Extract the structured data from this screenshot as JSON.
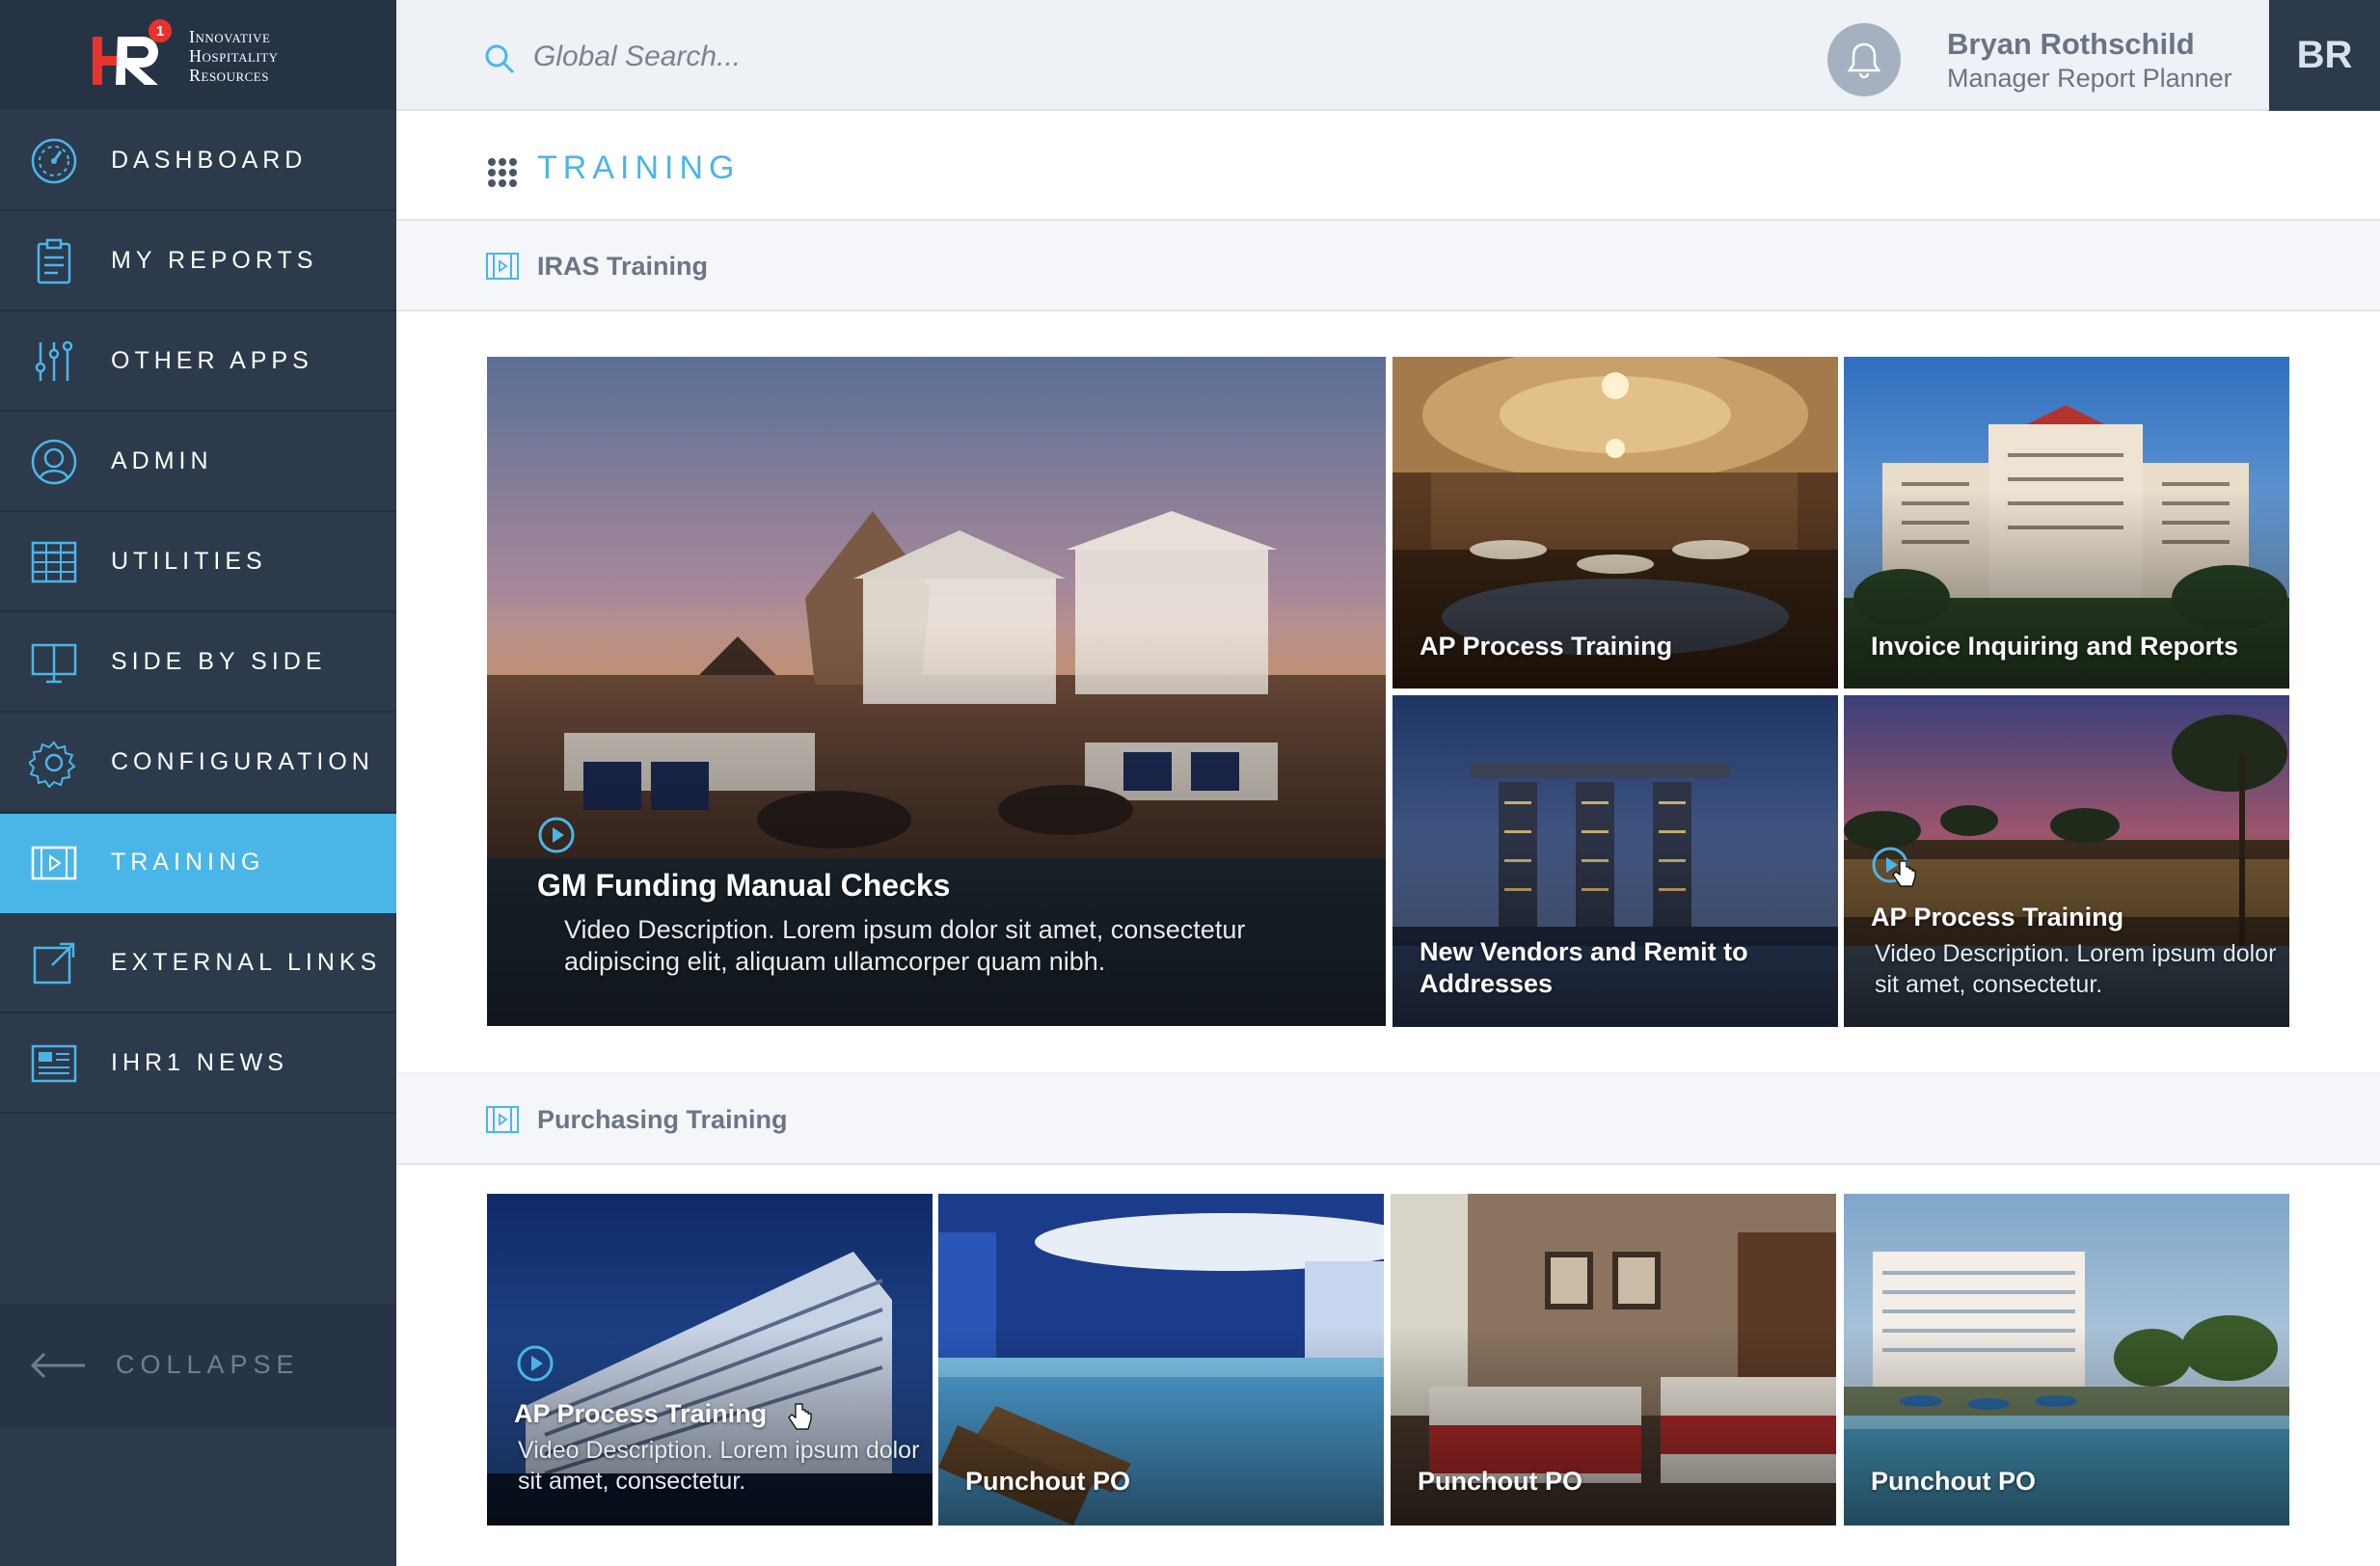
{
  "brand": {
    "logo_mark": "HR",
    "logo_badge": "1",
    "logo_lines": [
      "Innovative",
      "Hospitality",
      "Resources"
    ]
  },
  "sidebar": {
    "items": [
      {
        "label": "DASHBOARD",
        "icon": "dashboard-gauge-icon"
      },
      {
        "label": "MY REPORTS",
        "icon": "clipboard-icon"
      },
      {
        "label": "OTHER APPS",
        "icon": "sliders-icon"
      },
      {
        "label": "ADMIN",
        "icon": "user-circle-icon"
      },
      {
        "label": "UTILITIES",
        "icon": "table-grid-icon"
      },
      {
        "label": "SIDE BY SIDE",
        "icon": "monitor-icon"
      },
      {
        "label": "CONFIGURATION",
        "icon": "gear-icon"
      },
      {
        "label": "TRAINING",
        "icon": "film-icon",
        "active": true
      },
      {
        "label": "EXTERNAL LINKS",
        "icon": "external-link-icon"
      },
      {
        "label": "IHR1 NEWS",
        "icon": "newspaper-icon"
      }
    ],
    "collapse_label": "COLLAPSE"
  },
  "topbar": {
    "search_placeholder": "Global Search...",
    "user_name": "Bryan Rothschild",
    "user_role": "Manager Report Planner",
    "avatar_initials": "BR"
  },
  "page": {
    "title": "TRAINING"
  },
  "sections": [
    {
      "title": "IRAS Training",
      "tiles": [
        {
          "title": "GM Funding Manual Checks",
          "desc": "Video Description. Lorem ipsum dolor sit amet, consectetur adipiscing elit, aliquam ullamcorper quam nibh.",
          "play": true,
          "scene": "rooftop-lounge-sunset"
        },
        {
          "title": "AP Process Training",
          "scene": "ornate-ballroom"
        },
        {
          "title": "Invoice Inquiring and Reports",
          "scene": "resort-hotel-facade"
        },
        {
          "title": "New Vendors and Remit to Addresses",
          "scene": "city-skyline-dusk"
        },
        {
          "title": "AP Process Training",
          "desc": "Video Description. Lorem ipsum dolor sit amet, consectetur.",
          "play": true,
          "scene": "tropical-resort-dusk"
        }
      ]
    },
    {
      "title": "Purchasing Training",
      "tiles": [
        {
          "title": "AP Process Training",
          "desc": "Video Description. Lorem ipsum dolor sit amet, consectetur.",
          "play": true,
          "scene": "modern-hotel-night"
        },
        {
          "title": "Punchout PO",
          "scene": "indoor-pool"
        },
        {
          "title": "Punchout PO",
          "scene": "hotel-bedroom"
        },
        {
          "title": "Punchout PO",
          "scene": "beach-resort-pool"
        }
      ]
    }
  ],
  "colors": {
    "sidebar_bg": "#2c3a4c",
    "accent": "#4ab6e8",
    "logo_red": "#e8322e"
  }
}
